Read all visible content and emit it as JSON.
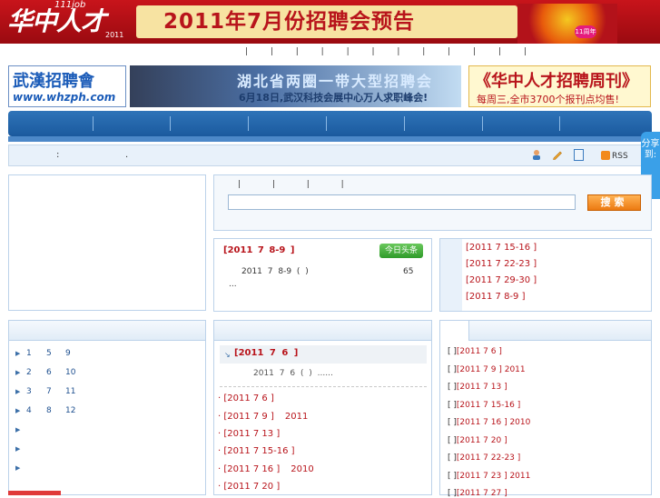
{
  "banner": {
    "logo_text": "华中人才",
    "logo_top": "111job",
    "logo_year": "2011",
    "headline": "2011年7月份招聘会预告",
    "badge": "11周年"
  },
  "top_links": "| | | | | | | | | | | |",
  "ads": {
    "whzph_title": "武漢招聘會",
    "whzph_url": "www.whzph.com",
    "fair_title": "湖北省两圈一带大型招聘会",
    "fair_sub": "6月18日,武汉科技会展中心万人求职峰会!",
    "weekly_title": "《华中人才招聘周刊》",
    "weekly_sub": "每周三,全市3700个报刊点均售!"
  },
  "info_bar": {
    "colon": ":",
    "dot": ".",
    "rss": "RSS"
  },
  "share": {
    "label": "分享到:"
  },
  "search": {
    "tabs": "| | | |",
    "placeholder": "",
    "button": "搜索"
  },
  "news": {
    "headline": "[2011 7 8-9 ]",
    "badge": "今日头条",
    "summary": "2011 7 8-9 (  )",
    "count": "65",
    "ellipsis": "..."
  },
  "events": [
    "[2011 7 15-16 ]",
    "[2011 7 22-23 ]",
    "[2011 7 29-30 ]",
    "[2011 7 8-9 ]"
  ],
  "left_list": {
    "rows": [
      {
        "a": "1",
        "b": "5",
        "c": "9"
      },
      {
        "a": "2",
        "b": "6",
        "c": "10"
      },
      {
        "a": "3",
        "b": "7",
        "c": "11"
      },
      {
        "a": "4",
        "b": "8",
        "c": "12"
      },
      {
        "a": "",
        "b": "",
        "c": ""
      },
      {
        "a": "",
        "b": "",
        "c": ""
      },
      {
        "a": "",
        "b": "",
        "c": ""
      }
    ]
  },
  "mid": {
    "feature_label": "[2011 7 6 ]",
    "feature_desc": "2011 7 6 ( )        ......",
    "items": [
      {
        "label": "· [2011 7 6 ]",
        "extra": ""
      },
      {
        "label": "· [2011 7 9 ]",
        "extra": "2011"
      },
      {
        "label": "· [2011 7 13 ]",
        "extra": ""
      },
      {
        "label": "· [2011 7 15-16 ]",
        "extra": ""
      },
      {
        "label": "· [2011 7 16 ]",
        "extra": "2010"
      },
      {
        "label": "· [2011 7 20 ]",
        "extra": ""
      }
    ]
  },
  "right_list": [
    {
      "label": "[2011 7 6 ]",
      "extra": ""
    },
    {
      "label": "[2011 7 9 ]",
      "extra": "2011"
    },
    {
      "label": "[2011 7 13 ]",
      "extra": ""
    },
    {
      "label": "[2011 7 15-16 ]",
      "extra": ""
    },
    {
      "label": "[2011 7 16 ]",
      "extra": "2010"
    },
    {
      "label": "[2011 7 20 ]",
      "extra": ""
    },
    {
      "label": "[2011 7 22-23 ]",
      "extra": ""
    },
    {
      "label": "[2011 7 23 ]",
      "extra": "2011"
    },
    {
      "label": "[2011 7 27 ]",
      "extra": ""
    }
  ],
  "right_bracket": "[   ]"
}
